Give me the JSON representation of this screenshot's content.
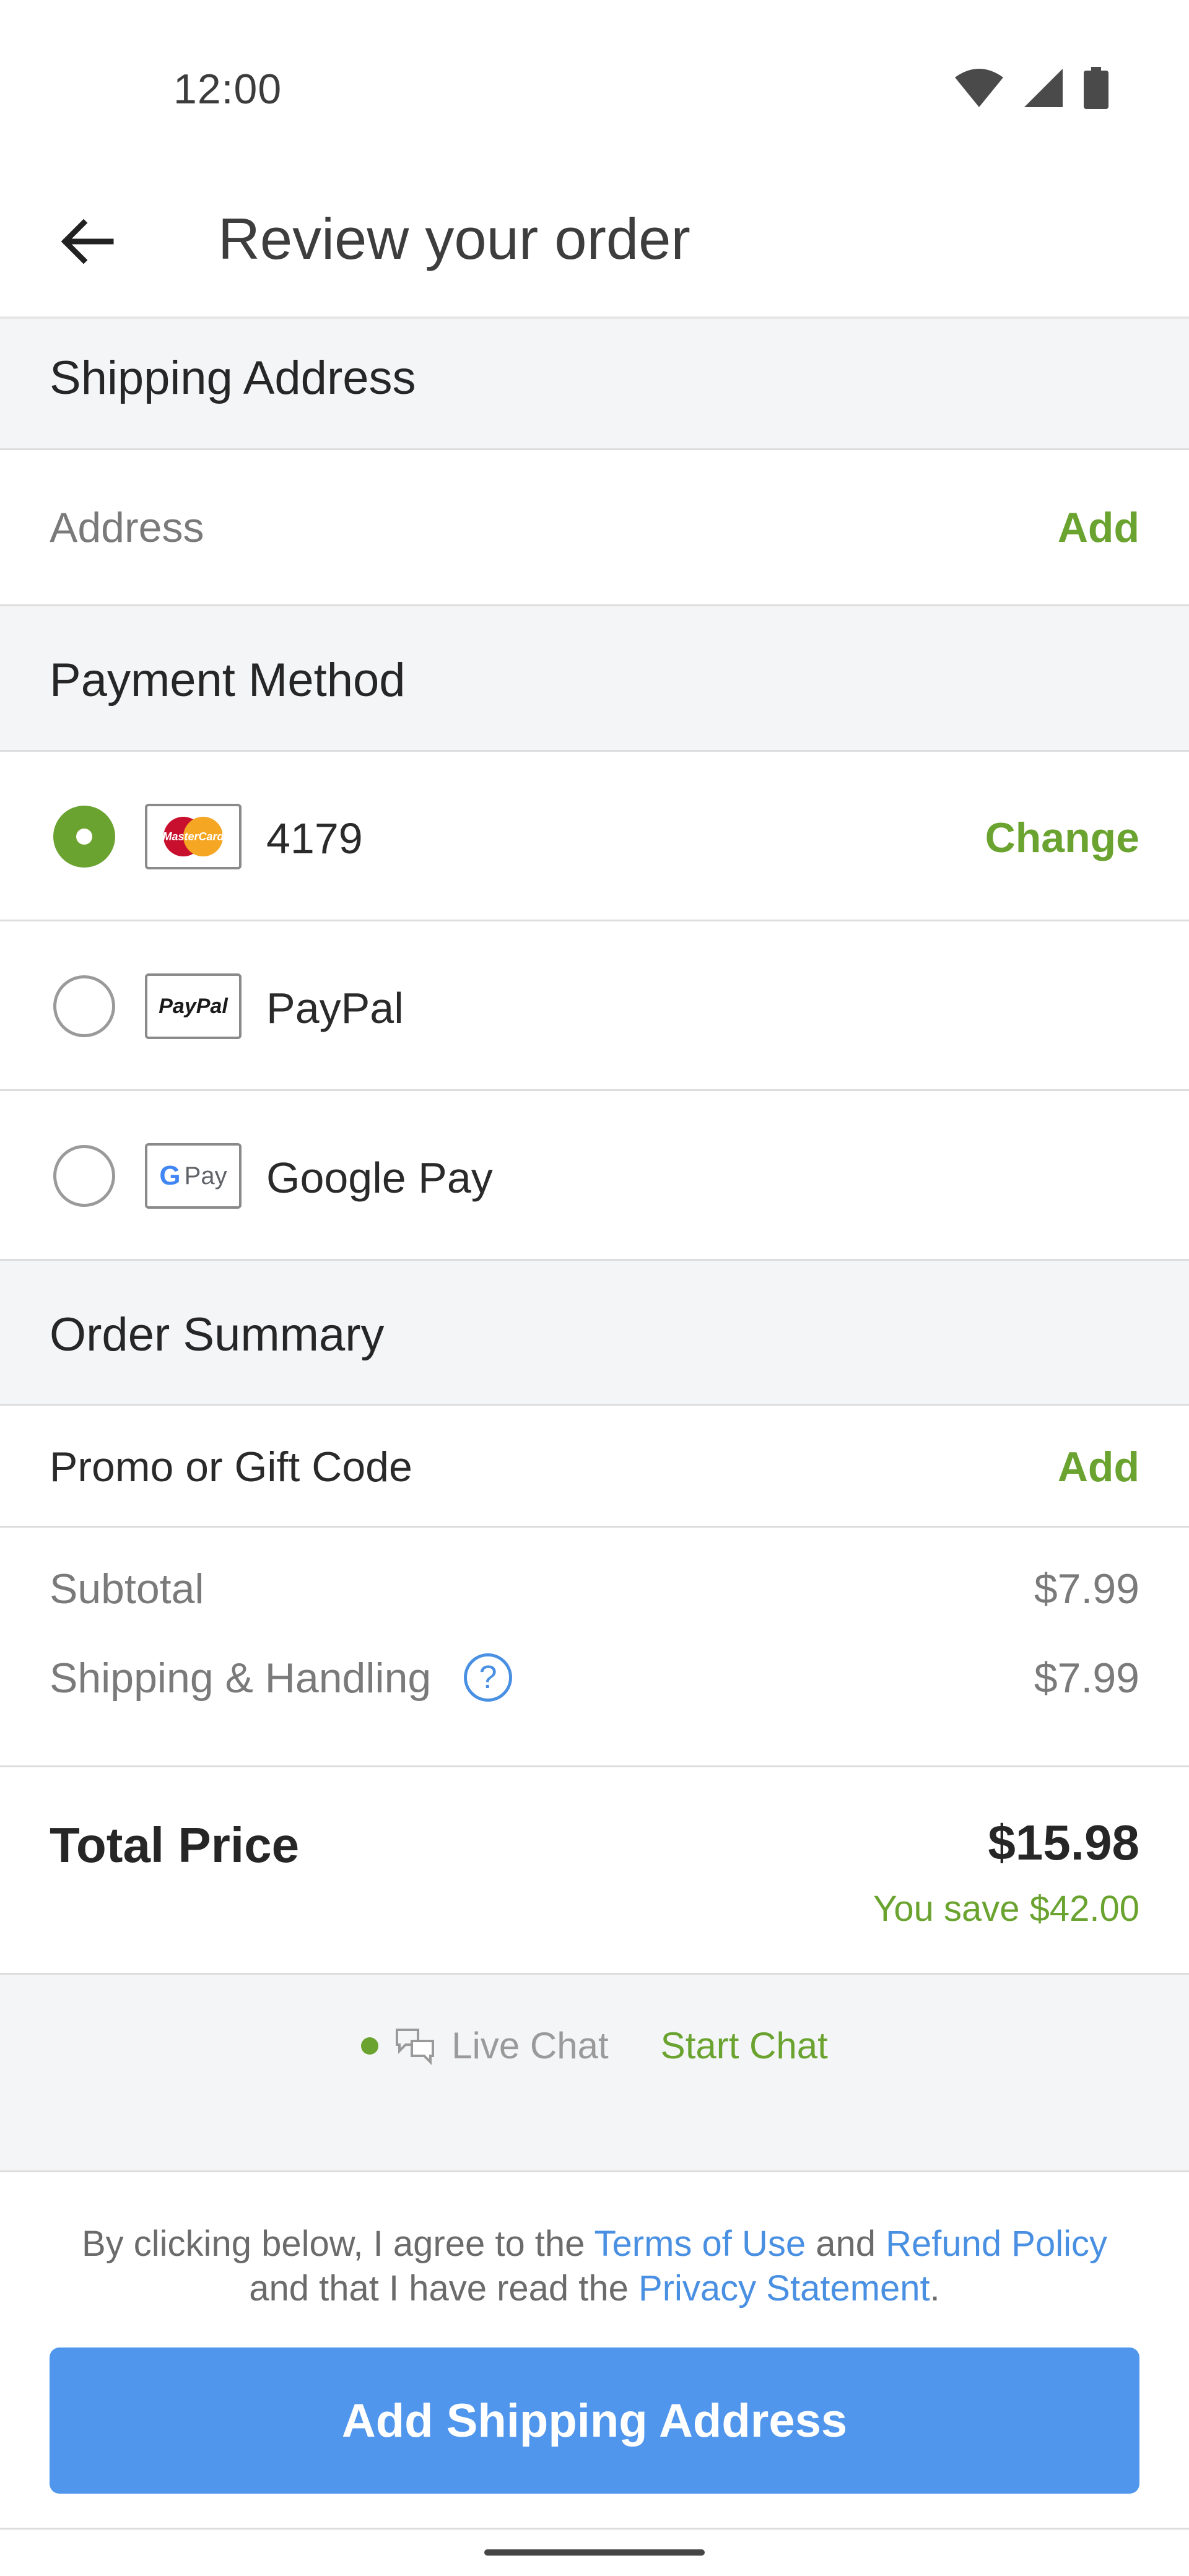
{
  "status_bar": {
    "time": "12:00",
    "icons": [
      "wifi-icon",
      "signal-icon",
      "battery-icon"
    ]
  },
  "app_bar": {
    "back_icon": "arrow-left-icon",
    "title": "Review your order"
  },
  "shipping": {
    "header": "Shipping Address",
    "address_label": "Address",
    "add_label": "Add"
  },
  "payment": {
    "header": "Payment Method",
    "methods": [
      {
        "logo": "mastercard-logo",
        "logo_text": "MasterCard",
        "label": "4179",
        "selected": true,
        "action": "Change"
      },
      {
        "logo": "paypal-logo",
        "logo_text": "PayPal",
        "label": "PayPal",
        "selected": false
      },
      {
        "logo": "google-pay-logo",
        "logo_text": "Pay",
        "label": "Google Pay",
        "selected": false
      }
    ]
  },
  "order_summary": {
    "header": "Order Summary",
    "promo_label": "Promo or Gift Code",
    "promo_action": "Add",
    "subtotal_label": "Subtotal",
    "subtotal_value": "$7.99",
    "shipping_label": "Shipping & Handling",
    "shipping_help_icon": "question-circle-icon",
    "shipping_value": "$7.99",
    "total_label": "Total Price",
    "total_value": "$15.98",
    "savings": "You save $42.00"
  },
  "chat": {
    "status_color": "#6aa32f",
    "label": "Live Chat",
    "icon": "chat-bubbles-icon",
    "action": "Start Chat"
  },
  "footer": {
    "legal_prefix": "By clicking below, I agree to the ",
    "terms_link": "Terms of Use",
    "legal_and": " and ",
    "refund_link": "Refund Policy",
    "legal_middle": " and that I have read the ",
    "privacy_link": "Privacy Statement",
    "legal_suffix": ".",
    "button_label": "Add Shipping Address"
  },
  "colors": {
    "accent_green": "#6aa32f",
    "link_blue": "#4a90e2",
    "button_blue": "#4f96ec",
    "section_bg": "#f4f5f7"
  }
}
